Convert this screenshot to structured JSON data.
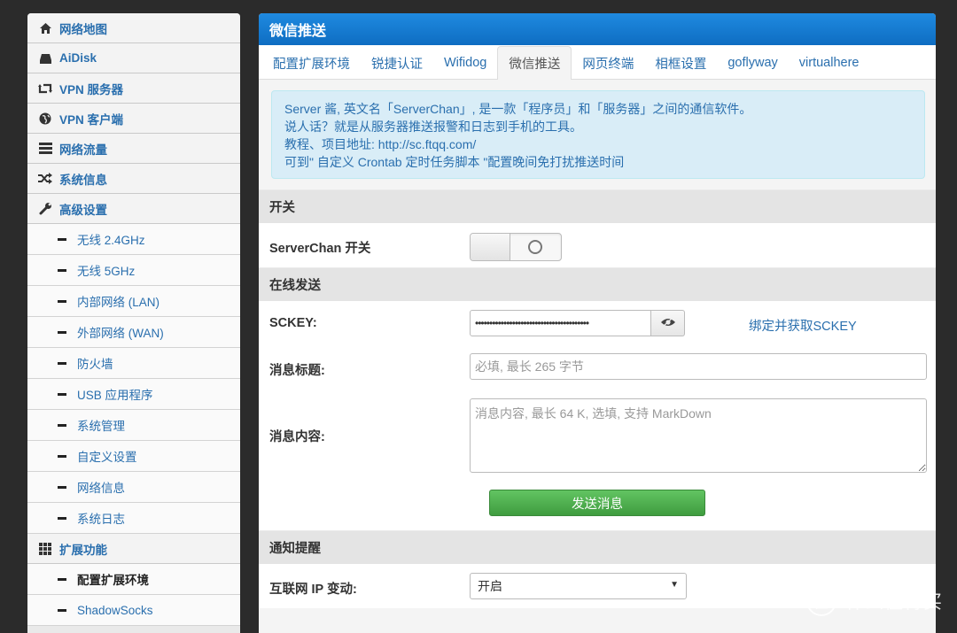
{
  "sidebar": {
    "items": [
      {
        "label": "网络地图",
        "icon": "home-icon"
      },
      {
        "label": "AiDisk",
        "icon": "hdd-icon"
      },
      {
        "label": "VPN 服务器",
        "icon": "retweet-icon"
      },
      {
        "label": "VPN 客户端",
        "icon": "globe-icon"
      },
      {
        "label": "网络流量",
        "icon": "list-icon"
      },
      {
        "label": "系统信息",
        "icon": "random-icon"
      },
      {
        "label": "高级设置",
        "icon": "wrench-icon"
      }
    ],
    "advanced_sub": [
      "无线 2.4GHz",
      "无线 5GHz",
      "内部网络 (LAN)",
      "外部网络 (WAN)",
      "防火墙",
      "USB 应用程序",
      "系统管理",
      "自定义设置",
      "网络信息",
      "系统日志"
    ],
    "ext": {
      "label": "扩展功能",
      "icon": "grid-icon"
    },
    "ext_sub": [
      "配置扩展环境",
      "ShadowSocks"
    ]
  },
  "main": {
    "title": "微信推送",
    "tabs": [
      "配置扩展环境",
      "锐捷认证",
      "Wifidog",
      "微信推送",
      "网页终端",
      "相框设置",
      "goflyway",
      "virtualhere"
    ],
    "active_tab": "微信推送",
    "info": [
      "Server 酱, 英文名「ServerChan」, 是一款「程序员」和「服务器」之间的通信软件。",
      "说人话？就是从服务器推送报警和日志到手机的工具。",
      "教程、项目地址: http://sc.ftqq.com/",
      "可到\" 自定义 Crontab 定时任务脚本 \"配置晚间免打扰推送时间"
    ],
    "sections": {
      "switch": "开关",
      "online": "在线发送",
      "notify": "通知提醒"
    },
    "switch_label": "ServerChan 开关",
    "switch_state": false,
    "sckey_label": "SCKEY:",
    "sckey_value": "••••••••••••••••••••••••••••••••••••••••",
    "sckey_link": "绑定并获取SCKEY",
    "title_label": "消息标题:",
    "title_placeholder": "必填, 最长 265 字节",
    "content_label": "消息内容:",
    "content_placeholder": "消息内容, 最长 64 K, 选填, 支持 MarkDown",
    "send_label": "发送消息",
    "ip_label": "互联网 IP 变动:",
    "ip_value": "开启"
  },
  "watermark": {
    "badge": "值",
    "text": "什么值得买"
  }
}
